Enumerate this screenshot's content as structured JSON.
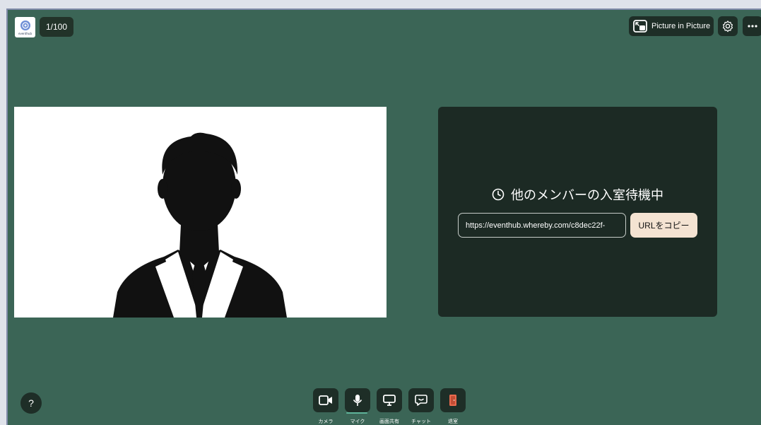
{
  "header": {
    "logo_text": "eventhub",
    "participant_count": "1/100",
    "pip_label": "Picture in Picture"
  },
  "waiting": {
    "title": "他のメンバーの入室待機中",
    "room_url": "https://eventhub.whereby.com/c8dec22f-",
    "copy_label": "URLをコピー"
  },
  "help": {
    "label": "?"
  },
  "toolbar": {
    "camera_label": "カメラ",
    "mic_label": "マイク",
    "share_label": "画面共有",
    "chat_label": "チャット",
    "leave_label": "退室"
  },
  "colors": {
    "background": "#3b6556",
    "panel": "#1c2a24",
    "button": "#1e2e27",
    "copy_button": "#f4e3d2",
    "leave_accent": "#e86a4e",
    "mic_indicator": "#5fb49a"
  },
  "icons": {
    "logo": "eventhub-logo-icon",
    "pip": "picture-in-picture-icon",
    "settings": "gear-icon",
    "more": "more-dots-icon",
    "clock": "clock-icon",
    "camera": "camera-icon",
    "mic": "microphone-icon",
    "share": "screen-share-icon",
    "chat": "chat-icon",
    "leave": "leave-door-icon",
    "avatar": "user-silhouette-icon"
  }
}
